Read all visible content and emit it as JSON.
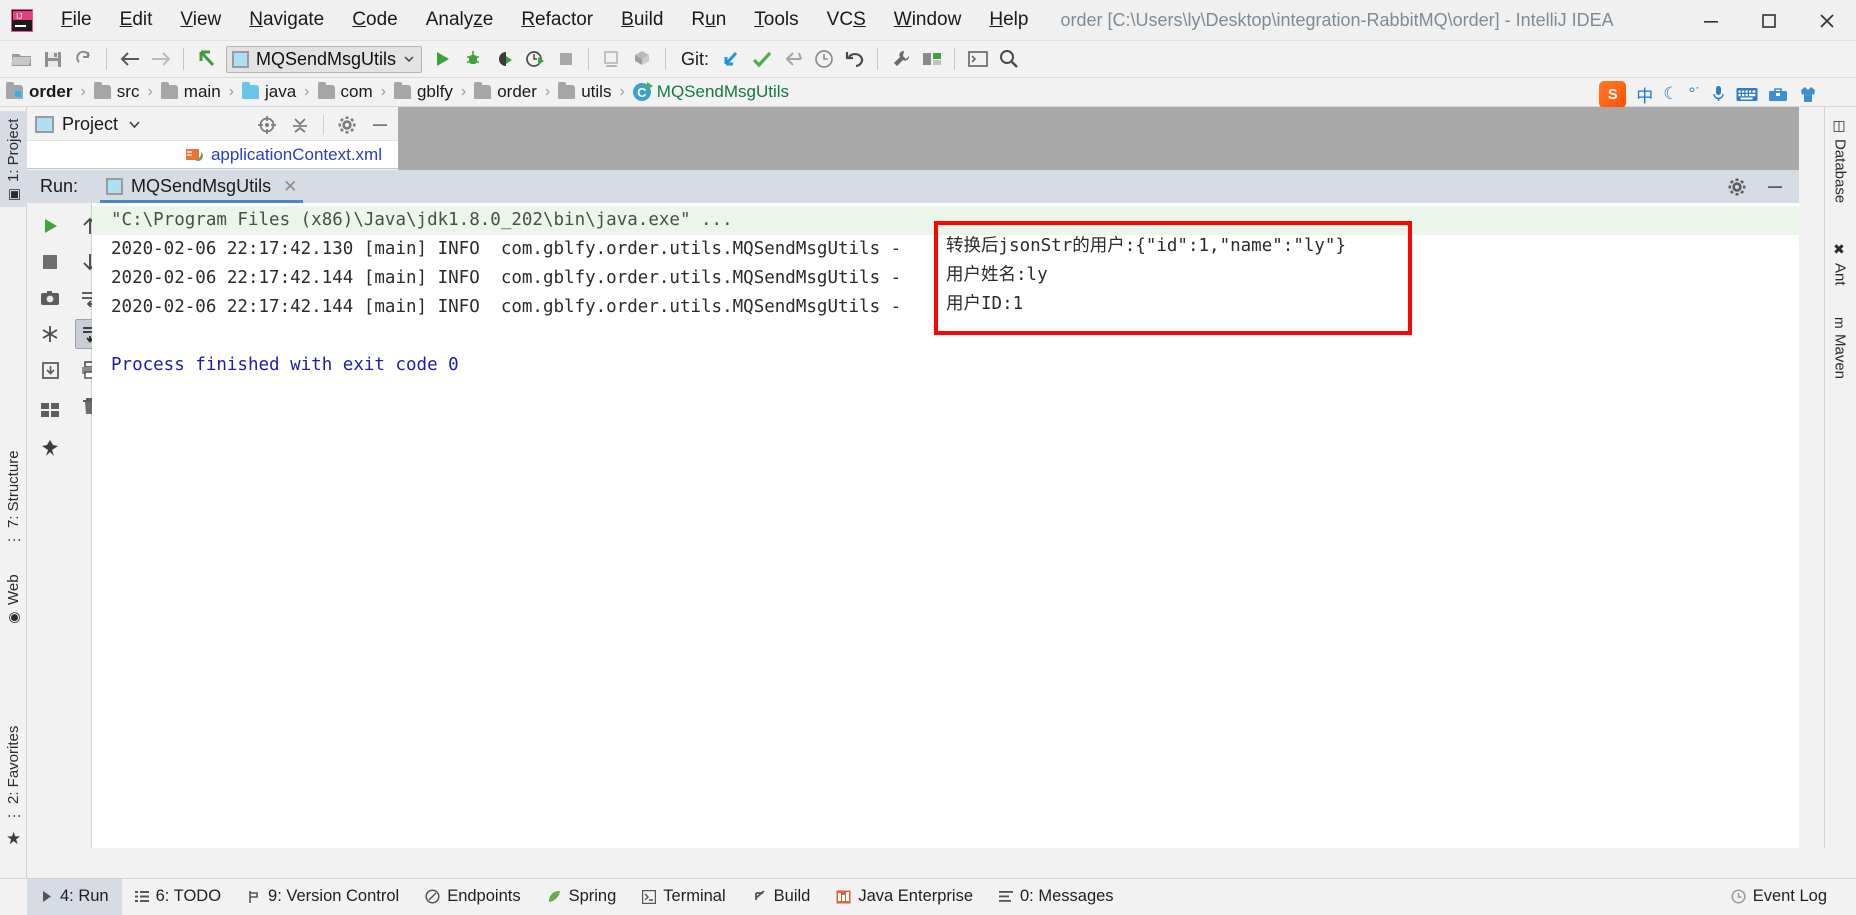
{
  "titlebar": {
    "logo_icon": "intellij-logo",
    "menus": [
      {
        "label": "File",
        "mnemonic": "F"
      },
      {
        "label": "Edit",
        "mnemonic": "E"
      },
      {
        "label": "View",
        "mnemonic": "V"
      },
      {
        "label": "Navigate",
        "mnemonic": "N"
      },
      {
        "label": "Code",
        "mnemonic": "C"
      },
      {
        "label": "Analyze",
        "mnemonic": "z"
      },
      {
        "label": "Refactor",
        "mnemonic": "R"
      },
      {
        "label": "Build",
        "mnemonic": "B"
      },
      {
        "label": "Run",
        "mnemonic": "u"
      },
      {
        "label": "Tools",
        "mnemonic": "T"
      },
      {
        "label": "VCS",
        "mnemonic": "S"
      },
      {
        "label": "Window",
        "mnemonic": "W"
      },
      {
        "label": "Help",
        "mnemonic": "H"
      }
    ],
    "window_title": "order [C:\\Users\\ly\\Desktop\\integration-RabbitMQ\\order] - IntelliJ IDEA",
    "buttons": [
      {
        "name": "minimize-button",
        "glyph": "—"
      },
      {
        "name": "maximize-button",
        "glyph": "☐"
      },
      {
        "name": "close-button",
        "glyph": "✕"
      }
    ]
  },
  "toolbar": {
    "icons": [
      {
        "name": "open-project-icon",
        "glyph": "📂"
      },
      {
        "name": "save-all-icon",
        "glyph": "💾"
      },
      {
        "name": "sync-refresh-icon",
        "glyph": "↺"
      },
      {
        "name": "back-icon",
        "glyph": "←"
      },
      {
        "name": "forward-icon",
        "glyph": "→"
      },
      {
        "name": "jump-to-source-icon",
        "glyph": "↖"
      }
    ],
    "run_config": {
      "name": "MQSendMsgUtils",
      "dropdown_icon": "chevron-down-icon"
    },
    "run_controls": [
      {
        "name": "run-icon",
        "glyph": "▶"
      },
      {
        "name": "debug-icon",
        "glyph": "🐞"
      },
      {
        "name": "run-with-coverage-icon",
        "glyph": "◑"
      },
      {
        "name": "profile-icon",
        "glyph": "◴"
      },
      {
        "name": "stop-icon",
        "glyph": "■"
      }
    ],
    "build_controls": [
      {
        "name": "build-project-icon",
        "glyph": "⬚"
      },
      {
        "name": "build-module-icon",
        "glyph": "⧉"
      }
    ],
    "git_label": "Git:",
    "git_controls": [
      {
        "name": "update-project-icon",
        "glyph": "↙"
      },
      {
        "name": "commit-icon",
        "glyph": "✔"
      },
      {
        "name": "push-icon",
        "glyph": "⇥"
      },
      {
        "name": "git-history-icon",
        "glyph": "◷"
      },
      {
        "name": "rollback-icon",
        "glyph": "↶"
      }
    ],
    "misc_controls": [
      {
        "name": "settings-wrench-icon",
        "glyph": "🔧"
      },
      {
        "name": "project-structure-icon",
        "glyph": "◨"
      },
      {
        "name": "terminal-icon",
        "glyph": "⬒"
      },
      {
        "name": "search-everywhere-icon",
        "glyph": "🔍"
      }
    ]
  },
  "breadcrumb": {
    "items": [
      {
        "label": "order",
        "icon": "project-folder-icon",
        "style": "bold"
      },
      {
        "label": "src",
        "icon": "folder-icon",
        "style": "normal"
      },
      {
        "label": "main",
        "icon": "folder-icon",
        "style": "normal"
      },
      {
        "label": "java",
        "icon": "source-folder-icon",
        "style": "normal"
      },
      {
        "label": "com",
        "icon": "folder-icon",
        "style": "normal"
      },
      {
        "label": "gblfy",
        "icon": "folder-icon",
        "style": "normal"
      },
      {
        "label": "order",
        "icon": "folder-icon",
        "style": "normal"
      },
      {
        "label": "utils",
        "icon": "folder-icon",
        "style": "normal"
      },
      {
        "label": "MQSendMsgUtils",
        "icon": "java-class-icon",
        "style": "green"
      }
    ],
    "separator": "›"
  },
  "tray": {
    "items": [
      {
        "name": "sogou-input-icon",
        "label": "S"
      },
      {
        "name": "chinese-mode-icon",
        "label": "中"
      },
      {
        "name": "moon-icon",
        "label": "☽"
      },
      {
        "name": "emoji-icon",
        "label": "°˚"
      },
      {
        "name": "microphone-icon",
        "label": "🎤"
      },
      {
        "name": "keyboard-icon",
        "label": "⌨"
      },
      {
        "name": "toolbox-icon",
        "label": "🗂"
      },
      {
        "name": "skin-icon",
        "label": "👕"
      }
    ]
  },
  "left_stripe": {
    "tabs": [
      {
        "label": "1: Project",
        "icon": "project-icon",
        "selected": true
      },
      {
        "label": "7: Structure",
        "icon": "structure-icon",
        "selected": false
      },
      {
        "label": "Web",
        "icon": "web-icon",
        "selected": false
      },
      {
        "label": "2: Favorites",
        "icon": "favorites-icon",
        "selected": false
      }
    ]
  },
  "right_stripe": {
    "tabs": [
      {
        "label": "Database",
        "icon": "database-icon"
      },
      {
        "label": "Ant",
        "icon": "ant-icon"
      },
      {
        "label": "Maven",
        "icon": "maven-icon"
      }
    ]
  },
  "project_panel": {
    "title": "Project",
    "dropdown_icon": "chevron-down-icon",
    "actions": [
      {
        "name": "scroll-from-source-icon",
        "glyph": "⨁"
      },
      {
        "name": "collapse-all-icon",
        "glyph": "⩥"
      },
      {
        "name": "gear-icon",
        "glyph": "⚙"
      },
      {
        "name": "hide-icon",
        "glyph": "—"
      }
    ],
    "open_file": "applicationContext.xml"
  },
  "run_panel": {
    "label": "Run:",
    "tab": {
      "name": "MQSendMsgUtils",
      "close_icon": "close-icon"
    },
    "header_actions": [
      {
        "name": "gear-icon",
        "glyph": "⚙"
      },
      {
        "name": "hide-icon",
        "glyph": "—"
      }
    ],
    "gutter_left": [
      {
        "name": "rerun-icon",
        "glyph": "▶",
        "color": "#3c9f3c",
        "selected": false
      },
      {
        "name": "stop-icon",
        "glyph": "■",
        "color": "#6f6f6f",
        "selected": false
      },
      {
        "name": "screenshot-icon",
        "glyph": "⬛",
        "color": "#4a4a4a",
        "selected": false
      },
      {
        "name": "print-thread-dump-icon",
        "glyph": "❄",
        "color": "#4a4a4a",
        "selected": false
      },
      {
        "name": "export-icon",
        "glyph": "⬇",
        "color": "#4a4a4a",
        "selected": false
      },
      {
        "name": "layout-icon",
        "glyph": "▦",
        "color": "#4a4a4a",
        "selected": false
      },
      {
        "name": "pin-tab-icon",
        "glyph": "📌",
        "color": "#4a4a4a",
        "selected": false
      }
    ],
    "gutter_right": [
      {
        "name": "scroll-up-icon",
        "glyph": "↑",
        "selected": false
      },
      {
        "name": "scroll-down-icon",
        "glyph": "↓",
        "selected": false
      },
      {
        "name": "soft-wrap-icon",
        "glyph": "↩",
        "selected": false
      },
      {
        "name": "scroll-to-end-icon",
        "glyph": "↧",
        "selected": true
      },
      {
        "name": "print-icon",
        "glyph": "⎙",
        "selected": false
      },
      {
        "name": "clear-all-icon",
        "glyph": "🗑",
        "selected": false
      }
    ]
  },
  "console": {
    "command_line": "\"C:\\Program Files (x86)\\Java\\jdk1.8.0_202\\bin\\java.exe\" ...",
    "log_lines": [
      "2020-02-06 22:17:42.130 [main] INFO  com.gblfy.order.utils.MQSendMsgUtils -",
      "2020-02-06 22:17:42.144 [main] INFO  com.gblfy.order.utils.MQSendMsgUtils -",
      "2020-02-06 22:17:42.144 [main] INFO  com.gblfy.order.utils.MQSendMsgUtils -"
    ],
    "exit_line": "Process finished with exit code 0",
    "highlight_box": {
      "border_color": "#fb0505",
      "lines": [
        "转换后jsonStr的用户:{\"id\":1,\"name\":\"ly\"}",
        "用户姓名:ly",
        "用户ID:1"
      ]
    }
  },
  "statusbar": {
    "items": [
      {
        "label": "4: Run",
        "icon": "run-icon",
        "selected": true
      },
      {
        "label": "6: TODO",
        "icon": "todo-icon",
        "selected": false
      },
      {
        "label": "9: Version Control",
        "icon": "version-control-icon",
        "selected": false
      },
      {
        "label": "Endpoints",
        "icon": "endpoints-icon",
        "selected": false
      },
      {
        "label": "Spring",
        "icon": "spring-leaf-icon",
        "selected": false
      },
      {
        "label": "Terminal",
        "icon": "terminal-icon",
        "selected": false
      },
      {
        "label": "Build",
        "icon": "build-hammer-icon",
        "selected": false
      },
      {
        "label": "Java Enterprise",
        "icon": "java-enterprise-icon",
        "selected": false
      },
      {
        "label": "0: Messages",
        "icon": "messages-icon",
        "selected": false
      }
    ],
    "event_log": {
      "label": "Event Log",
      "icon": "event-log-icon"
    }
  },
  "colors": {
    "accent_blue": "#4a86c7",
    "selection": "#d6dbe4",
    "console_cmd_bg": "#ebf5e9",
    "highlight_red": "#fb0505",
    "link_blue": "#2540c0",
    "exit_blue": "#1d1da8"
  }
}
